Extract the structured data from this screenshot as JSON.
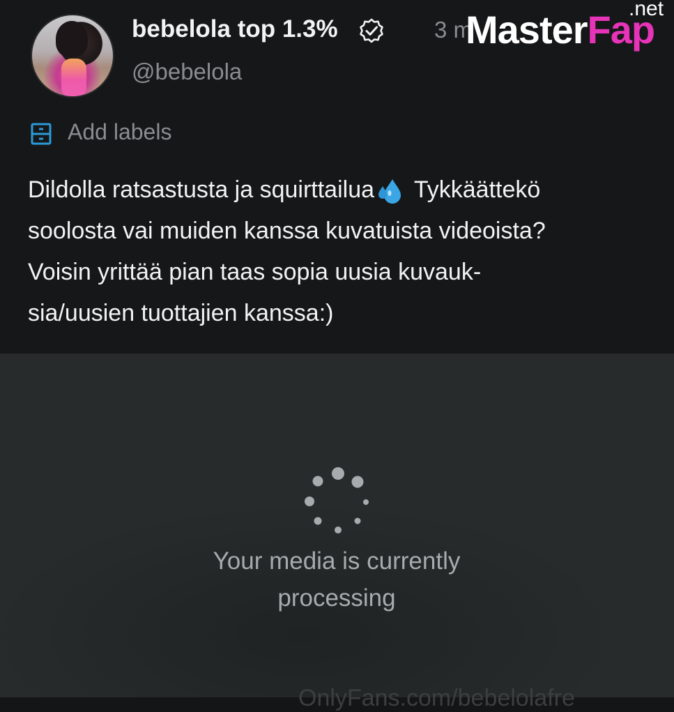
{
  "profile": {
    "display_name": "bebelola top 1.3%",
    "handle": "@bebelola",
    "time_ago": "3 m"
  },
  "watermark": {
    "main": "Master",
    "accent": "Fap",
    "suffix": ".net"
  },
  "labels": {
    "add_label": "Add labels"
  },
  "post": {
    "line1_before": "Dildolla ratsastusta ja squirttailua",
    "line1_after": " Tykkäättekö",
    "line2": "soolosta vai muiden kanssa kuvatuista videoista?",
    "line3": "Voisin yrittää pian taas sopia uusia kuvauk-",
    "line4": "sia/uusien tuottajien kanssa:)"
  },
  "media": {
    "status_line1": "Your media is currently",
    "status_line2": "processing"
  },
  "footer": {
    "url": "OnlyFans.com/bebelolafre"
  },
  "colors": {
    "background": "#161718",
    "media_background": "#272b2b",
    "text_primary": "#f2f3f4",
    "text_secondary": "#8a8d90",
    "accent_blue": "#2a9bd8",
    "watermark_pink": "#e633b8"
  },
  "icons": {
    "verified": "verified-badge-icon",
    "labels": "labels-icon",
    "emoji": "sweat-droplets-icon",
    "spinner": "loading-spinner-icon"
  }
}
